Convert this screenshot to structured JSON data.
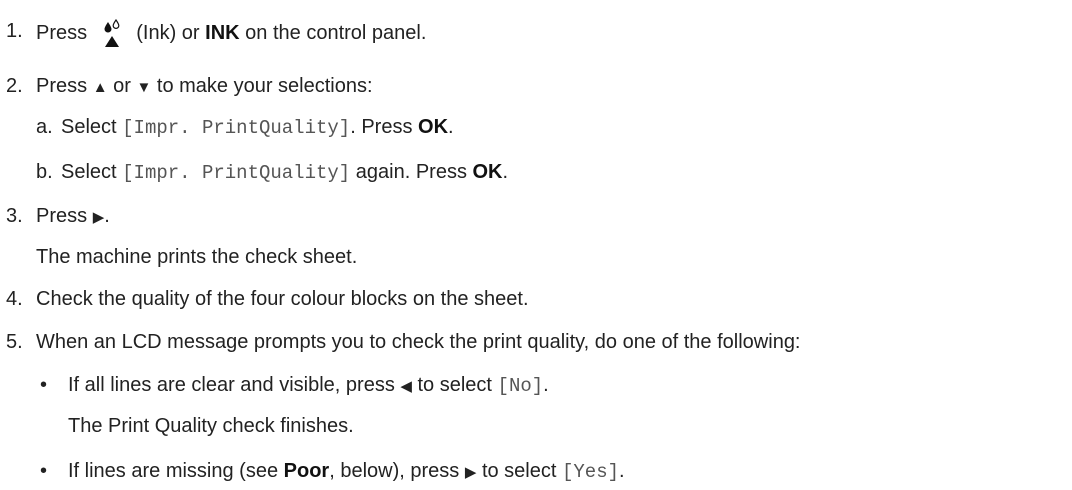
{
  "steps": [
    {
      "num": "1.",
      "pre": "Press",
      "icon_name": "ink-drops-icon",
      "mid": "(Ink) or",
      "bold": "INK",
      "post": "on the control panel."
    },
    {
      "num": "2.",
      "pre": "Press",
      "up": "▲",
      "or": "or",
      "down": "▼",
      "post": "to make your selections:",
      "substeps": [
        {
          "letter": "a.",
          "pre": "Select",
          "code": "[Impr. PrintQuality]",
          "mid": ". Press",
          "bold": "OK",
          "end": "."
        },
        {
          "letter": "b.",
          "pre": "Select",
          "code": "[Impr. PrintQuality]",
          "mid": "again. Press",
          "bold": "OK",
          "end": "."
        }
      ]
    },
    {
      "num": "3.",
      "pre": "Press",
      "right": "▶",
      "post": ".",
      "result": "The machine prints the check sheet."
    },
    {
      "num": "4.",
      "text": "Check the quality of the four colour blocks on the sheet."
    },
    {
      "num": "5.",
      "text": "When an LCD message prompts you to check the print quality, do one of the following:",
      "bullets": [
        {
          "bullet": "•",
          "pre": "If all lines are clear and visible, press",
          "arrow": "◀",
          "mid": "to select",
          "code": "[No]",
          "end": ".",
          "result": "The Print Quality check finishes."
        },
        {
          "bullet": "•",
          "pre": "If lines are missing (see",
          "bold": "Poor",
          "mid": ", below), press",
          "arrow": "▶",
          "mid2": "to select",
          "code": "[Yes]",
          "end": "."
        }
      ]
    }
  ]
}
